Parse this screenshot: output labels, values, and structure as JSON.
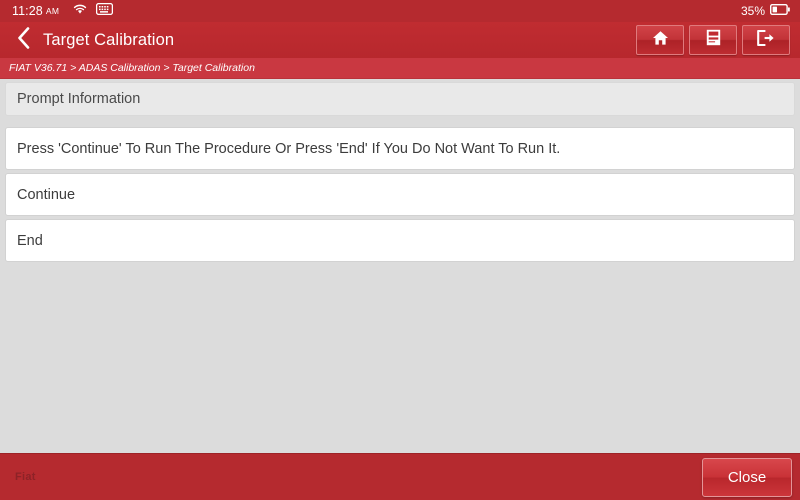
{
  "statusbar": {
    "time": "11:28",
    "ampm": "AM",
    "wifi_icon": "wifi-icon",
    "keyboard_icon": "keyboard-icon",
    "battery_percent": "35%",
    "battery_icon": "battery-icon"
  },
  "titlebar": {
    "back_icon": "chevron-left-icon",
    "title": "Target Calibration",
    "tools": [
      {
        "name": "home-button",
        "icon": "home-icon"
      },
      {
        "name": "report-button",
        "icon": "report-icon"
      },
      {
        "name": "exit-button",
        "icon": "exit-icon"
      }
    ]
  },
  "breadcrumb": {
    "text": "FIAT V36.71 > ADAS Calibration > Target Calibration"
  },
  "main": {
    "header_label": "Prompt Information",
    "message": "Press 'Continue' To Run The Procedure Or Press 'End' If You Do Not Want To Run It.",
    "options": [
      {
        "label": "Continue"
      },
      {
        "label": "End"
      }
    ]
  },
  "bottombar": {
    "brand": "Fiat",
    "close_label": "Close"
  },
  "colors": {
    "header_red": "#b52a2f",
    "breadcrumb_red": "#c93841",
    "background_grey": "#dcdcdc",
    "row_white": "#ffffff",
    "row_header_grey": "#e9e9e9",
    "text_dark": "#3c3c3c"
  }
}
